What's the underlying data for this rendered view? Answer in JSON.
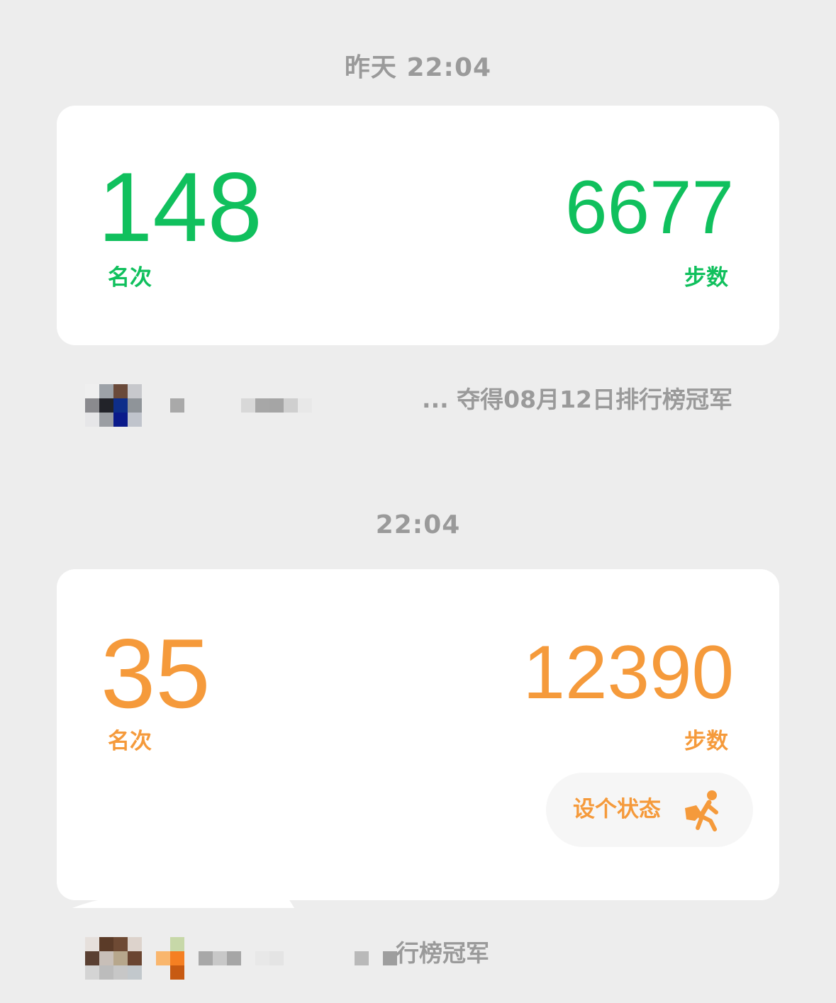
{
  "messages": [
    {
      "timestamp": "昨天 22:04",
      "rank_value": "148",
      "rank_label": "名次",
      "steps_value": "6677",
      "steps_label": "步数",
      "color": "#10c05d",
      "champion_text": "... 夺得08月12日排行榜冠军"
    },
    {
      "timestamp": "22:04",
      "rank_value": "35",
      "rank_label": "名次",
      "steps_value": "12390",
      "steps_label": "步数",
      "color": "#f59a3b",
      "status_button": {
        "label": "设个状态",
        "icon": "running-person-icon"
      },
      "champion_text": "行榜冠军"
    }
  ]
}
